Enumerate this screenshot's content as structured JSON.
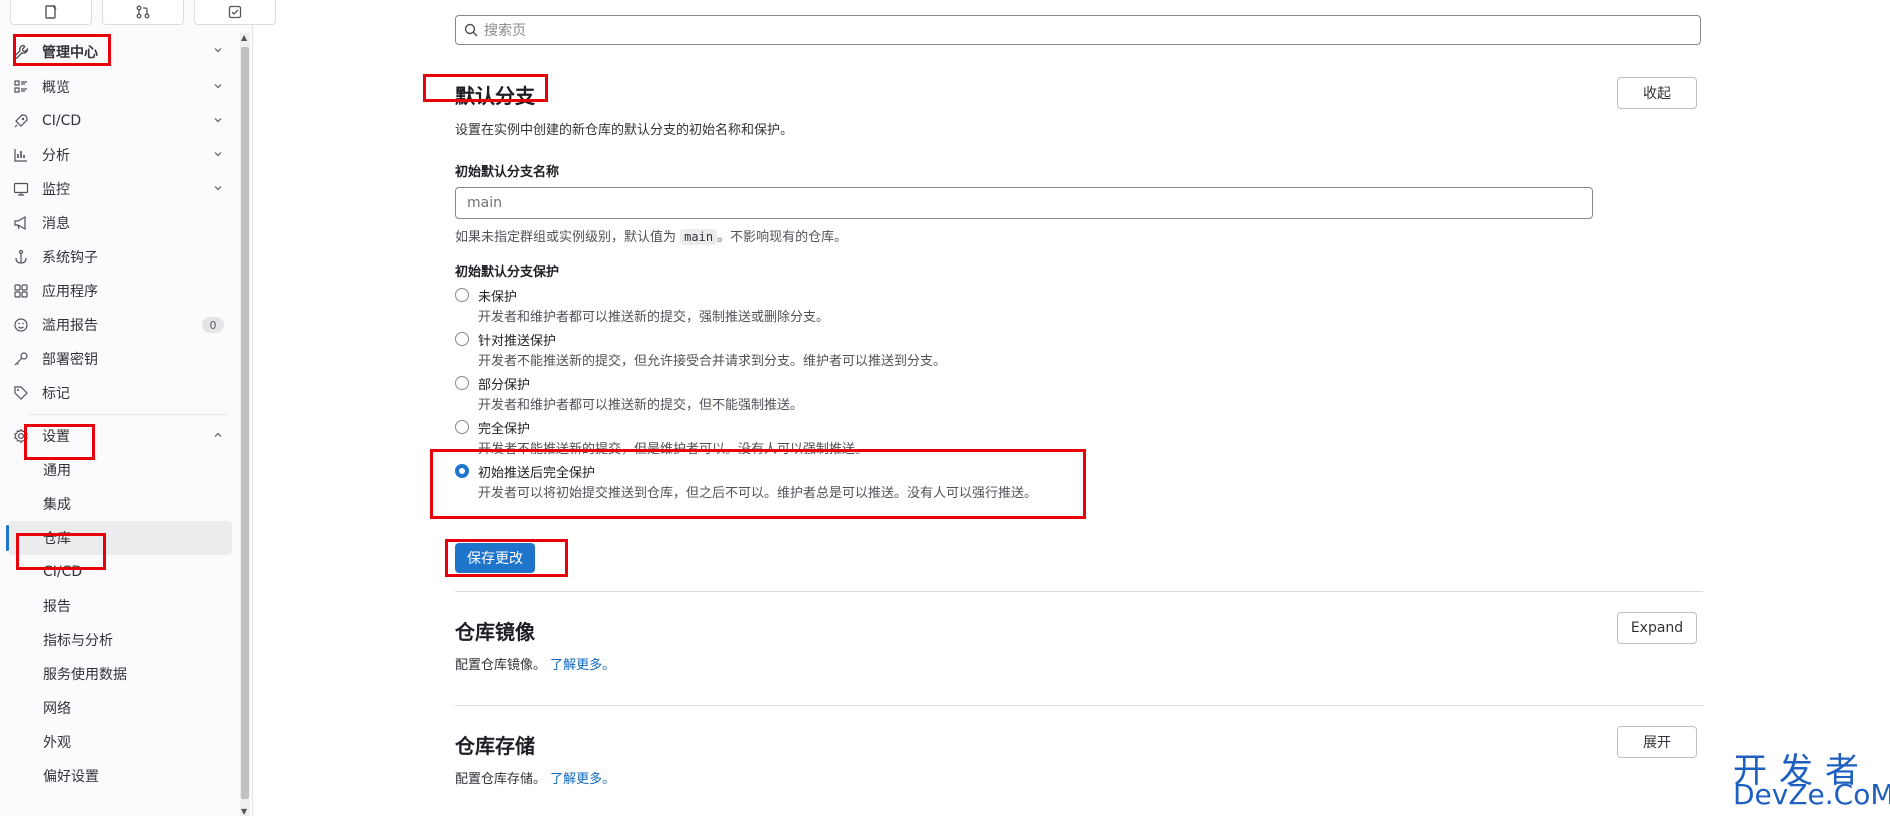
{
  "sidebar": {
    "admin": {
      "label": "管理中心"
    },
    "items": [
      {
        "label": "概览",
        "icon": "list-icon",
        "chevron": true
      },
      {
        "label": "CI/CD",
        "icon": "rocket-icon",
        "chevron": true
      },
      {
        "label": "分析",
        "icon": "chart-icon",
        "chevron": true
      },
      {
        "label": "监控",
        "icon": "monitor-icon",
        "chevron": true
      },
      {
        "label": "消息",
        "icon": "megaphone-icon",
        "chevron": false
      },
      {
        "label": "系统钩子",
        "icon": "anchor-icon",
        "chevron": false
      },
      {
        "label": "应用程序",
        "icon": "apps-icon",
        "chevron": false
      },
      {
        "label": "滥用报告",
        "icon": "smiley-icon",
        "chevron": false,
        "badge": "0"
      },
      {
        "label": "部署密钥",
        "icon": "key-icon",
        "chevron": false
      },
      {
        "label": "标记",
        "icon": "tag-icon",
        "chevron": false
      }
    ],
    "settings": {
      "label": "设置",
      "children": [
        "通用",
        "集成",
        "仓库",
        "CI/CD",
        "报告",
        "指标与分析",
        "服务使用数据",
        "网络",
        "外观",
        "偏好设置"
      ],
      "active": "仓库"
    }
  },
  "search": {
    "placeholder": "搜索页"
  },
  "default_branch": {
    "title": "默认分支",
    "button": "收起",
    "description": "设置在实例中创建的新仓库的默认分支的初始名称和保护。",
    "name_label": "初始默认分支名称",
    "name_value": "main",
    "help_pre": "如果未指定群组或实例级别，默认值为",
    "help_code": "main",
    "help_post": "。不影响现有的仓库。",
    "protection_label": "初始默认分支保护",
    "options": [
      {
        "label": "未保护",
        "help": "开发者和维护者都可以推送新的提交，强制推送或删除分支。",
        "checked": false
      },
      {
        "label": "针对推送保护",
        "help": "开发者不能推送新的提交，但允许接受合并请求到分支。维护者可以推送到分支。",
        "checked": false
      },
      {
        "label": "部分保护",
        "help": "开发者和维护者都可以推送新的提交，但不能强制推送。",
        "checked": false
      },
      {
        "label": "完全保护",
        "help": "开发者不能推送新的提交，但是维护者可以。没有人可以强制推送。",
        "checked": false
      },
      {
        "label": "初始推送后完全保护",
        "help": "开发者可以将初始提交推送到仓库，但之后不可以。维护者总是可以推送。没有人可以强行推送。",
        "checked": true
      }
    ],
    "save": "保存更改"
  },
  "mirror": {
    "title": "仓库镜像",
    "button": "Expand",
    "desc": "配置仓库镜像。",
    "link": "了解更多。"
  },
  "storage": {
    "title": "仓库存储",
    "button": "展开",
    "desc": "配置仓库存储。",
    "link": "了解更多。"
  },
  "watermark": {
    "line1": "开发者",
    "line2": "DevZe.CoM"
  },
  "colors": {
    "primary": "#1f75cb",
    "annotation": "#e8000b",
    "link": "#1068bf"
  }
}
